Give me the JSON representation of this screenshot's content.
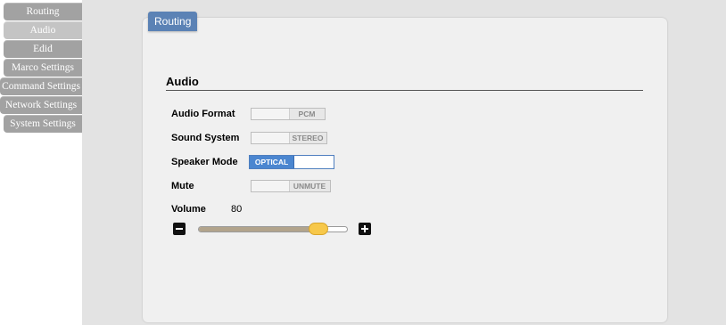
{
  "nav": {
    "items": [
      {
        "label": "Routing"
      },
      {
        "label": "Audio"
      },
      {
        "label": "Edid"
      },
      {
        "label": "Marco Settings"
      },
      {
        "label": "Command Settings"
      },
      {
        "label": "Network Settings"
      },
      {
        "label": "System Settings"
      }
    ],
    "active": "Audio"
  },
  "panel": {
    "tab_label": "Routing",
    "section_title": "Audio"
  },
  "audio": {
    "format": {
      "label": "Audio Format",
      "value": "PCM"
    },
    "sound_system": {
      "label": "Sound System",
      "value": "STEREO"
    },
    "speaker_mode": {
      "label": "Speaker Mode",
      "value": "OPTICAL"
    },
    "mute": {
      "label": "Mute",
      "value": "UNMUTE"
    },
    "volume": {
      "label": "Volume",
      "value": "80",
      "level": 80,
      "max": 100
    }
  },
  "colors": {
    "accent": "#5b82b5",
    "toggle_on": "#4b86d0",
    "slider_thumb": "#f7c84a",
    "nav_item": "#a2a2a2"
  },
  "icons": {
    "volume_down": "minus-icon",
    "volume_up": "plus-icon"
  }
}
